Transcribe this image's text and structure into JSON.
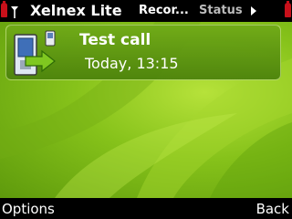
{
  "status_bar": {
    "app_title": "Xelnex Lite",
    "tabs": [
      {
        "label": "Recor...",
        "active": true
      },
      {
        "label": "Status",
        "active": false
      }
    ],
    "battery_color": "#c8101a"
  },
  "log": {
    "items": [
      {
        "name": "Test call",
        "time": "Today, 13:15",
        "icon": "outgoing-call-icon"
      }
    ]
  },
  "softkeys": {
    "left": "Options",
    "right": "Back"
  },
  "theme": {
    "accent": "#7bbd1a",
    "bar_background": "#000000"
  }
}
